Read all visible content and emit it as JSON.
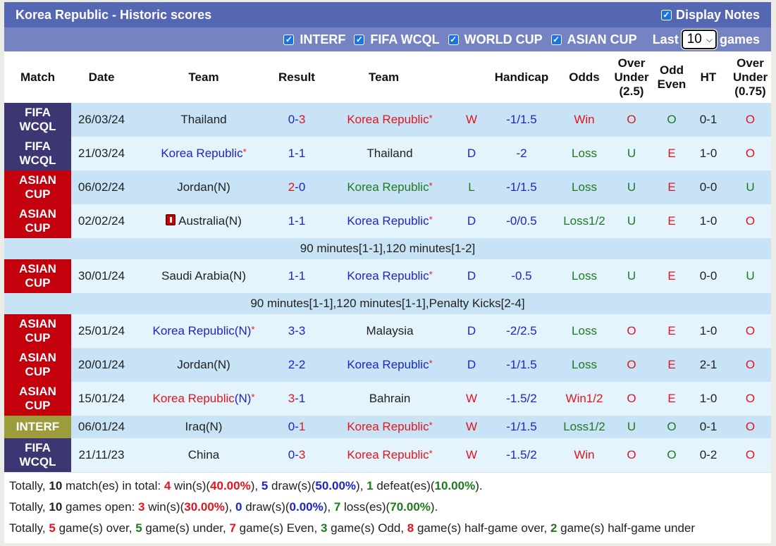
{
  "header": {
    "title": "Korea Republic - Historic scores",
    "display_notes_label": "Display Notes",
    "display_notes_checked": true
  },
  "filters": {
    "items": [
      {
        "label": "INTERF",
        "checked": true
      },
      {
        "label": "FIFA WCQL",
        "checked": true
      },
      {
        "label": "WORLD CUP",
        "checked": true
      },
      {
        "label": "ASIAN CUP",
        "checked": true
      }
    ],
    "last_label": "Last",
    "last_value": "10",
    "games_label": "games"
  },
  "columns": {
    "match": "Match",
    "date": "Date",
    "team_home": "Team",
    "result": "Result",
    "team_away": "Team",
    "handicap": "Handicap",
    "odds": "Odds",
    "ou_line1": "Over",
    "ou_line2": "Under",
    "ou_line3": "(2.5)",
    "oe_line1": "Odd",
    "oe_line2": "Even",
    "ht": "HT",
    "ou2_line1": "Over",
    "ou2_line2": "Under",
    "ou2_line3": "(0.75)"
  },
  "rows": [
    {
      "league1": "FIFA",
      "league2": "WCQL",
      "date": "26/03/24",
      "home": "Thailand",
      "home_suffix": "",
      "home_star": false,
      "hs": "0",
      "sep": "-",
      "as": "3",
      "away": "Korea Republic",
      "away_suffix": "",
      "away_star": true,
      "wl": "W",
      "handicap": "-1/1.5",
      "odds": "Win",
      "ou": "O",
      "oe": "O",
      "ht": "0-1",
      "ou2": "O"
    },
    {
      "league1": "FIFA",
      "league2": "WCQL",
      "date": "21/03/24",
      "home": "Korea Republic",
      "home_suffix": "",
      "home_star": true,
      "hs": "1",
      "sep": "-",
      "as": "1",
      "away": "Thailand",
      "away_suffix": "",
      "away_star": false,
      "wl": "D",
      "handicap": "-2",
      "odds": "Loss",
      "ou": "U",
      "oe": "E",
      "ht": "1-0",
      "ou2": "O"
    },
    {
      "league1": "ASIAN",
      "league2": "CUP",
      "date": "06/02/24",
      "home": "Jordan(N)",
      "home_suffix": "",
      "home_star": false,
      "hs": "2",
      "sep": "-",
      "as": "0",
      "away": "Korea Republic",
      "away_suffix": "",
      "away_star": true,
      "wl": "L",
      "handicap": "-1/1.5",
      "odds": "Loss",
      "ou": "U",
      "oe": "E",
      "ht": "0-0",
      "ou2": "U"
    },
    {
      "league1": "ASIAN",
      "league2": "CUP",
      "date": "02/02/24",
      "home": "Australia(N)",
      "home_suffix": "",
      "home_star": false,
      "home_redcard": true,
      "hs": "1",
      "sep": "-",
      "as": "1",
      "away": "Korea Republic",
      "away_suffix": "",
      "away_star": true,
      "wl": "D",
      "handicap": "-0/0.5",
      "odds": "Loss1/2",
      "ou": "U",
      "oe": "E",
      "ht": "1-0",
      "ou2": "O"
    },
    {
      "league1": "ASIAN",
      "league2": "CUP",
      "date": "30/01/24",
      "home": "Saudi Arabia(N)",
      "home_suffix": "",
      "home_star": false,
      "hs": "1",
      "sep": "-",
      "as": "1",
      "away": "Korea Republic",
      "away_suffix": "",
      "away_star": true,
      "wl": "D",
      "handicap": "-0.5",
      "odds": "Loss",
      "ou": "U",
      "oe": "E",
      "ht": "0-0",
      "ou2": "U"
    },
    {
      "league1": "ASIAN",
      "league2": "CUP",
      "date": "25/01/24",
      "home": "Korea Republic",
      "home_suffix": "(N)",
      "home_star": true,
      "hs": "3",
      "sep": "-",
      "as": "3",
      "away": "Malaysia",
      "away_suffix": "",
      "away_star": false,
      "wl": "D",
      "handicap": "-2/2.5",
      "odds": "Loss",
      "ou": "O",
      "oe": "E",
      "ht": "1-0",
      "ou2": "O"
    },
    {
      "league1": "ASIAN",
      "league2": "CUP",
      "date": "20/01/24",
      "home": "Jordan(N)",
      "home_suffix": "",
      "home_star": false,
      "hs": "2",
      "sep": "-",
      "as": "2",
      "away": "Korea Republic",
      "away_suffix": "",
      "away_star": true,
      "wl": "D",
      "handicap": "-1/1.5",
      "odds": "Loss",
      "ou": "O",
      "oe": "E",
      "ht": "2-1",
      "ou2": "O"
    },
    {
      "league1": "ASIAN",
      "league2": "CUP",
      "date": "15/01/24",
      "home": "Korea Republic",
      "home_suffix": "(N)",
      "home_star": true,
      "hs": "3",
      "sep": "-",
      "as": "1",
      "away": "Bahrain",
      "away_suffix": "",
      "away_star": false,
      "wl": "W",
      "handicap": "-1.5/2",
      "odds": "Win1/2",
      "ou": "O",
      "oe": "E",
      "ht": "1-0",
      "ou2": "O"
    },
    {
      "league1": "INTERF",
      "league2": "",
      "date": "06/01/24",
      "home": "Iraq(N)",
      "home_suffix": "",
      "home_star": false,
      "hs": "0",
      "sep": "-",
      "as": "1",
      "away": "Korea Republic",
      "away_suffix": "",
      "away_star": true,
      "wl": "W",
      "handicap": "-1/1.5",
      "odds": "Loss1/2",
      "ou": "U",
      "oe": "O",
      "ht": "0-1",
      "ou2": "O"
    },
    {
      "league1": "FIFA",
      "league2": "WCQL",
      "date": "21/11/23",
      "home": "China",
      "home_suffix": "",
      "home_star": false,
      "hs": "0",
      "sep": "-",
      "as": "3",
      "away": "Korea Republic",
      "away_suffix": "",
      "away_star": true,
      "wl": "W",
      "handicap": "-1.5/2",
      "odds": "Win",
      "ou": "O",
      "oe": "O",
      "ht": "0-2",
      "ou2": "O"
    }
  ],
  "notes": {
    "after_row_3": "90 minutes[1-1],120 minutes[1-2]",
    "after_row_4": "90 minutes[1-1],120 minutes[1-1],Penalty Kicks[2-4]"
  },
  "summary": {
    "line1": {
      "p1": "Totally, ",
      "total": "10",
      "p2": " match(es) in total: ",
      "wins": "4",
      "p3": " win(s)(",
      "win_pct": "40.00%",
      "p4": "), ",
      "draws": "5",
      "p5": " draw(s)(",
      "draw_pct": "50.00%",
      "p6": "), ",
      "defeats": "1",
      "p7": " defeat(es)(",
      "defeat_pct": "10.00%",
      "p8": ")."
    },
    "line2": {
      "p1": "Totally, ",
      "total": "10",
      "p2": " games open: ",
      "wins": "3",
      "p3": " win(s)(",
      "win_pct": "30.00%",
      "p4": "), ",
      "draws": "0",
      "p5": " draw(s)(",
      "draw_pct": "0.00%",
      "p6": "), ",
      "losses": "7",
      "p7": " loss(es)(",
      "loss_pct": "70.00%",
      "p8": ")."
    },
    "line3": {
      "p1": "Totally, ",
      "over": "5",
      "p2": " game(s) over, ",
      "under": "5",
      "p3": " game(s) under, ",
      "even": "7",
      "p4": " game(s) Even, ",
      "odd": "3",
      "p5": " game(s) Odd, ",
      "half_over": "8",
      "p6": " game(s) half-game over, ",
      "half_under": "2",
      "p7": " game(s) half-game under"
    }
  },
  "colors": {
    "title_bg": "#5567b2",
    "filter_bg": "#7683c2",
    "wcql": "#3c3773",
    "asian_cup": "#c4000c",
    "interf": "#9c9c3c",
    "row_dark": "#c7e3f5",
    "row_light": "#e4f4fc",
    "red": "#e3141e",
    "blue": "#1d24c9",
    "green": "#1e7a1e"
  }
}
